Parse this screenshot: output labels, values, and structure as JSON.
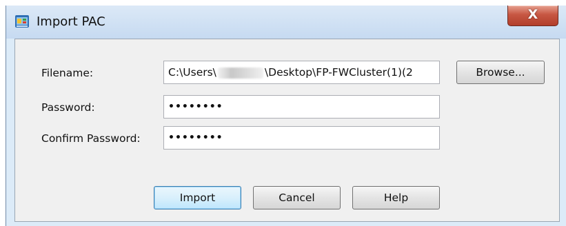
{
  "window": {
    "title": "Import PAC",
    "icon": "import-pac-app-icon",
    "close_glyph": "X"
  },
  "form": {
    "filename_label": "Filename:",
    "filename_before": "C:\\Users\\",
    "filename_after": "\\Desktop\\FP-FWCluster(1)(2",
    "password_label": "Password:",
    "password_value": "••••••••",
    "confirm_label": "Confirm Password:",
    "confirm_value": "••••••••"
  },
  "buttons": {
    "browse": "Browse...",
    "import": "Import",
    "cancel": "Cancel",
    "help": "Help"
  },
  "colors": {
    "titlebar": "#c6daf1",
    "client": "#f0f0f0",
    "close": "#c75743",
    "default_button_border": "#3c7fb1"
  }
}
